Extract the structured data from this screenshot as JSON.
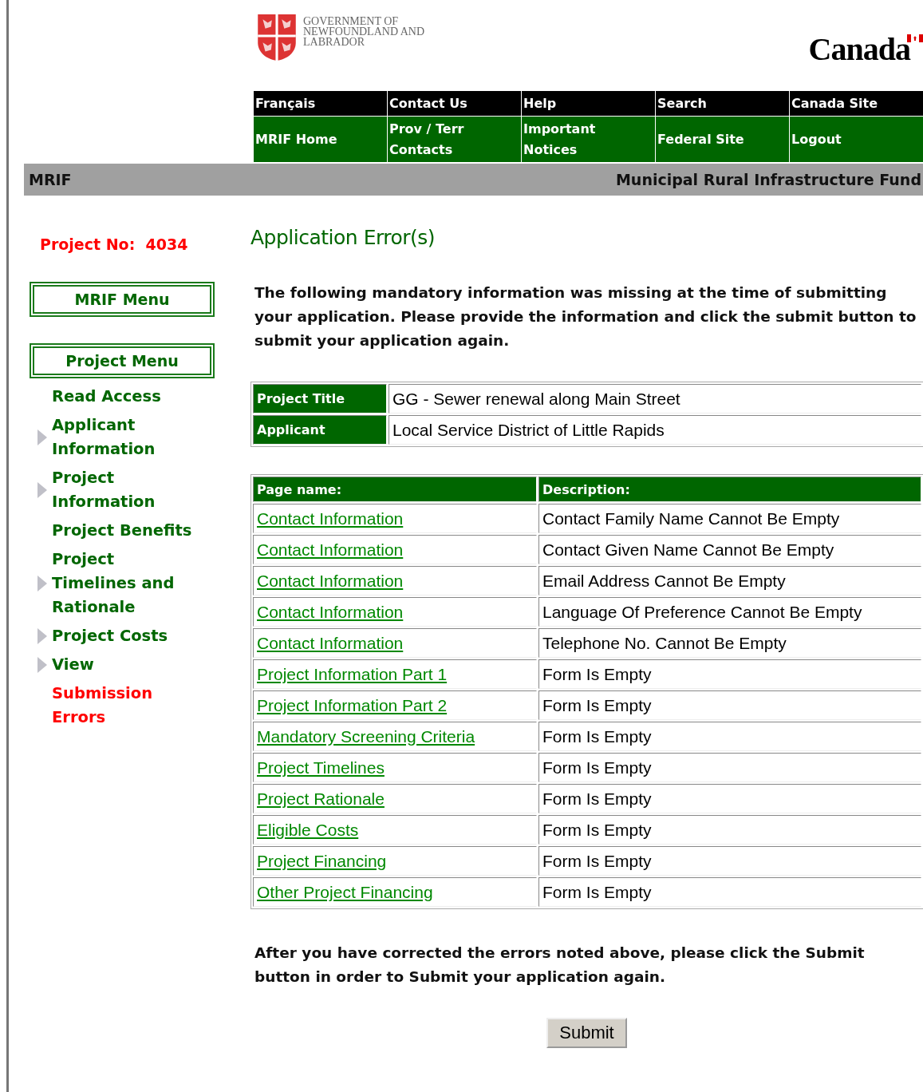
{
  "header": {
    "government_logo_text": "GOVERNMENT OF NEWFOUNDLAND AND LABRADOR",
    "wordmark": "Canada"
  },
  "nav": {
    "top_row": [
      "Français",
      "Contact Us",
      "Help",
      "Search",
      "Canada Site"
    ],
    "bottom_row": [
      "MRIF Home",
      "Prov / Terr Contacts",
      "Important Notices",
      "Federal Site",
      "Logout"
    ]
  },
  "banner": {
    "left": "MRIF",
    "right": "Municipal Rural Infrastructure Fund"
  },
  "sidebar": {
    "project_label": "Project No:",
    "project_number": "4034",
    "menu_buttons": [
      "MRIF Menu",
      "Project Menu"
    ],
    "items": [
      {
        "label": "Read Access",
        "has_submenu": false,
        "selected": false
      },
      {
        "label": "Applicant Information",
        "has_submenu": true,
        "selected": false
      },
      {
        "label": "Project Information",
        "has_submenu": true,
        "selected": false
      },
      {
        "label": "Project Benefits",
        "has_submenu": false,
        "selected": false
      },
      {
        "label": "Project Timelines and Rationale",
        "has_submenu": true,
        "selected": false
      },
      {
        "label": "Project Costs",
        "has_submenu": true,
        "selected": false
      },
      {
        "label": "View",
        "has_submenu": true,
        "selected": false
      },
      {
        "label": "Submission Errors",
        "has_submenu": false,
        "selected": true
      }
    ]
  },
  "main": {
    "title": "Application Error(s)",
    "intro": "The following mandatory information was missing at the time of submitting your application. Please provide the information and click the submit button to submit your application again.",
    "project_info": [
      {
        "label": "Project Title",
        "value": "GG - Sewer renewal along Main Street"
      },
      {
        "label": "Applicant",
        "value": "Local Service District of Little Rapids"
      }
    ],
    "errors_table": {
      "columns": [
        "Page name:",
        "Description:"
      ],
      "rows": [
        {
          "page": "Contact Information",
          "description": "Contact Family Name Cannot Be Empty"
        },
        {
          "page": "Contact Information",
          "description": "Contact Given Name Cannot Be Empty"
        },
        {
          "page": "Contact Information",
          "description": "Email Address Cannot Be Empty"
        },
        {
          "page": "Contact Information",
          "description": "Language Of Preference Cannot Be Empty"
        },
        {
          "page": "Contact Information",
          "description": "Telephone No. Cannot Be Empty"
        },
        {
          "page": "Project Information Part 1",
          "description": "Form Is Empty"
        },
        {
          "page": "Project Information Part 2",
          "description": "Form Is Empty"
        },
        {
          "page": "Mandatory Screening Criteria",
          "description": "Form Is Empty"
        },
        {
          "page": "Project Timelines",
          "description": "Form Is Empty"
        },
        {
          "page": "Project Rationale",
          "description": "Form Is Empty"
        },
        {
          "page": "Eligible Costs",
          "description": "Form Is Empty"
        },
        {
          "page": "Project Financing",
          "description": "Form Is Empty"
        },
        {
          "page": "Other Project Financing",
          "description": "Form Is Empty"
        }
      ]
    },
    "closing": "After you have corrected the errors noted above, please click the Submit button in order to Submit your application again.",
    "submit_button": "Submit"
  }
}
